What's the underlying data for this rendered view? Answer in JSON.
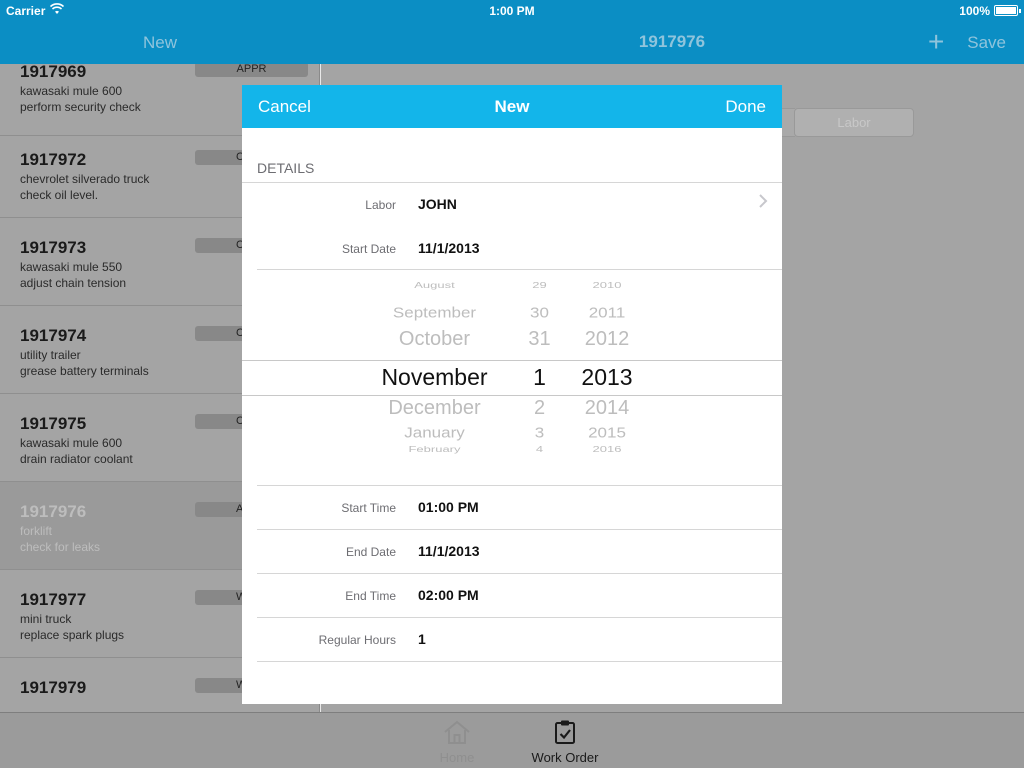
{
  "status": {
    "carrier": "Carrier",
    "time": "1:00 PM",
    "battery": "100%"
  },
  "nav": {
    "left_title": "New",
    "title": "1917976",
    "plus": "+",
    "save": "Save"
  },
  "work_orders": [
    {
      "number": "1917969",
      "line1": "kawasaki mule 600",
      "line2": "perform security check",
      "badge": "APPR"
    },
    {
      "number": "1917972",
      "line1": "chevrolet silverado truck",
      "line2": "check oil level.",
      "badge": "C"
    },
    {
      "number": "1917973",
      "line1": "kawasaki mule 550",
      "line2": "adjust chain tension",
      "badge": "C"
    },
    {
      "number": "1917974",
      "line1": "utility trailer",
      "line2": "grease battery terminals",
      "badge": "C"
    },
    {
      "number": "1917975",
      "line1": "kawasaki mule 600",
      "line2": "drain radiator coolant",
      "badge": "C"
    },
    {
      "number": "1917976",
      "line1": "forklift",
      "line2": "check for leaks",
      "badge": "A"
    },
    {
      "number": "1917977",
      "line1": "mini truck",
      "line2": "replace spark plugs",
      "badge": "W"
    },
    {
      "number": "1917979",
      "line1": "",
      "line2": "",
      "badge": "W"
    }
  ],
  "right_panel": {
    "segment_label": "Labor"
  },
  "tabs": {
    "home": "Home",
    "work_order": "Work Order"
  },
  "modal": {
    "cancel": "Cancel",
    "title": "New",
    "done": "Done",
    "section": "DETAILS",
    "fields": {
      "labor": {
        "label": "Labor",
        "value": "JOHN"
      },
      "start_date": {
        "label": "Start Date",
        "value": "11/1/2013"
      },
      "start_time": {
        "label": "Start Time",
        "value": "01:00 PM"
      },
      "end_date": {
        "label": "End Date",
        "value": "11/1/2013"
      },
      "end_time": {
        "label": "End Time",
        "value": "02:00 PM"
      },
      "regular_hours": {
        "label": "Regular Hours",
        "value": "1"
      }
    },
    "picker": {
      "months": [
        "August",
        "September",
        "October",
        "November",
        "December",
        "January",
        "February"
      ],
      "days": [
        "29",
        "30",
        "31",
        "1",
        "2",
        "3",
        "4"
      ],
      "years": [
        "2010",
        "2011",
        "2012",
        "2013",
        "2014",
        "2015",
        "2016"
      ],
      "selected_index": 3
    }
  }
}
